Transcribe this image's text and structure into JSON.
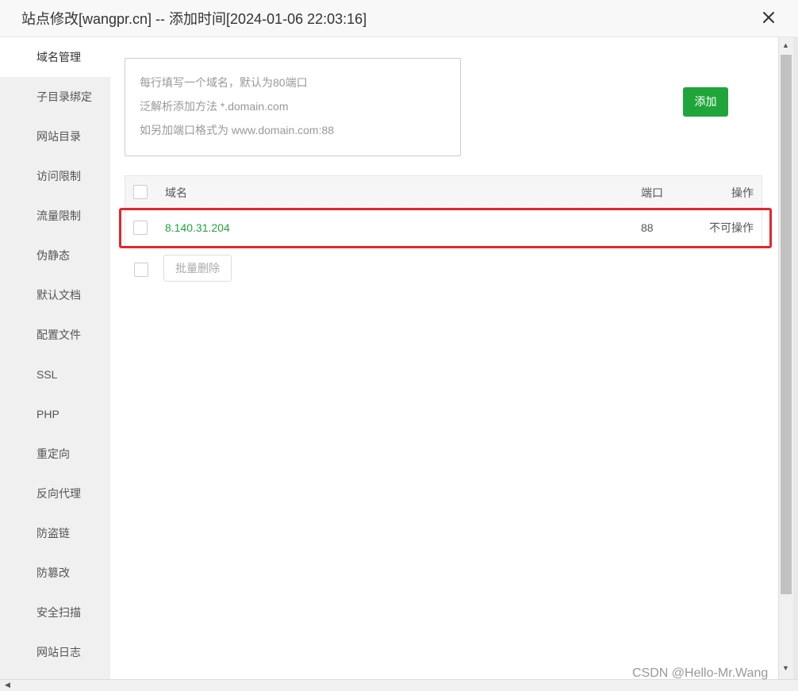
{
  "dialog": {
    "title": "站点修改[wangpr.cn] -- 添加时间[2024-01-06 22:03:16]",
    "close_icon": "close-icon"
  },
  "sidebar": {
    "items": [
      {
        "label": "域名管理",
        "active": true
      },
      {
        "label": "子目录绑定"
      },
      {
        "label": "网站目录"
      },
      {
        "label": "访问限制"
      },
      {
        "label": "流量限制"
      },
      {
        "label": "伪静态"
      },
      {
        "label": "默认文档"
      },
      {
        "label": "配置文件"
      },
      {
        "label": "SSL"
      },
      {
        "label": "PHP"
      },
      {
        "label": "重定向"
      },
      {
        "label": "反向代理"
      },
      {
        "label": "防盗链"
      },
      {
        "label": "防篡改"
      },
      {
        "label": "安全扫描"
      },
      {
        "label": "网站日志"
      }
    ]
  },
  "domain_input": {
    "placeholder_lines": [
      "每行填写一个域名，默认为80端口",
      "泛解析添加方法 *.domain.com",
      "如另加端口格式为 www.domain.com:88"
    ]
  },
  "add_button": {
    "label": "添加",
    "color": "#20a53a"
  },
  "table": {
    "headers": {
      "domain": "域名",
      "port": "端口",
      "action": "操作"
    },
    "rows": [
      {
        "domain": "8.140.31.204",
        "port": "88",
        "action": "不可操作"
      }
    ],
    "domain_color": "#20a53a"
  },
  "batch_delete": {
    "label": "批量删除"
  },
  "highlight_color": "#e5262b",
  "watermark": "CSDN @Hello-Mr.Wang"
}
